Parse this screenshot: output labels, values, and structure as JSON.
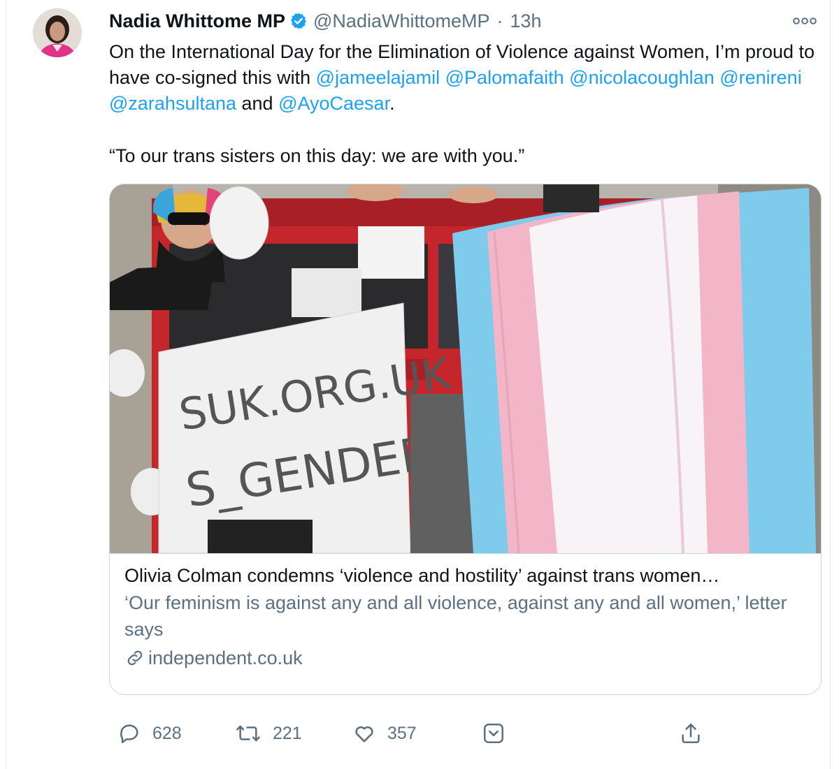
{
  "author": {
    "name": "Nadia Whittome MP",
    "handle": "@NadiaWhittomeMP",
    "separator": "·",
    "time": "13h"
  },
  "tweet": {
    "line1_pre": "On the International Day for the Elimination of Violence against Women, I’m proud to have co-signed this with ",
    "mentions": [
      "@jameelajamil",
      "@Palomafaith",
      "@nicolacoughlan",
      "@renireni",
      "@zarahsultana",
      "@AyoCaesar"
    ],
    "conjunction": " and ",
    "end_punct": ".",
    "quote": "“To our trans sisters on this day: we are with you.”"
  },
  "card": {
    "banner_text_1": "SUK.ORG.UK",
    "banner_text_2": "S_GENDER",
    "title": "Olivia Colman condemns ‘violence and hostility’ against trans women…",
    "description": "‘Our feminism is against any and all violence, against any and all women,’ letter says",
    "domain": "independent.co.uk"
  },
  "actions": {
    "replies": "628",
    "retweets": "221",
    "likes": "357"
  },
  "icons": {
    "verified": "verified-badge-icon",
    "more": "more-options-icon",
    "reply": "reply-icon",
    "retweet": "retweet-icon",
    "like": "heart-icon",
    "tip": "tip-jar-icon",
    "share": "share-icon",
    "link": "link-icon"
  },
  "colors": {
    "mention": "#1da1f2",
    "secondary_text": "#5b7083",
    "flag_blue": "#7ecbeb",
    "flag_pink": "#f2b6c8",
    "bus_red": "#c4262c"
  }
}
